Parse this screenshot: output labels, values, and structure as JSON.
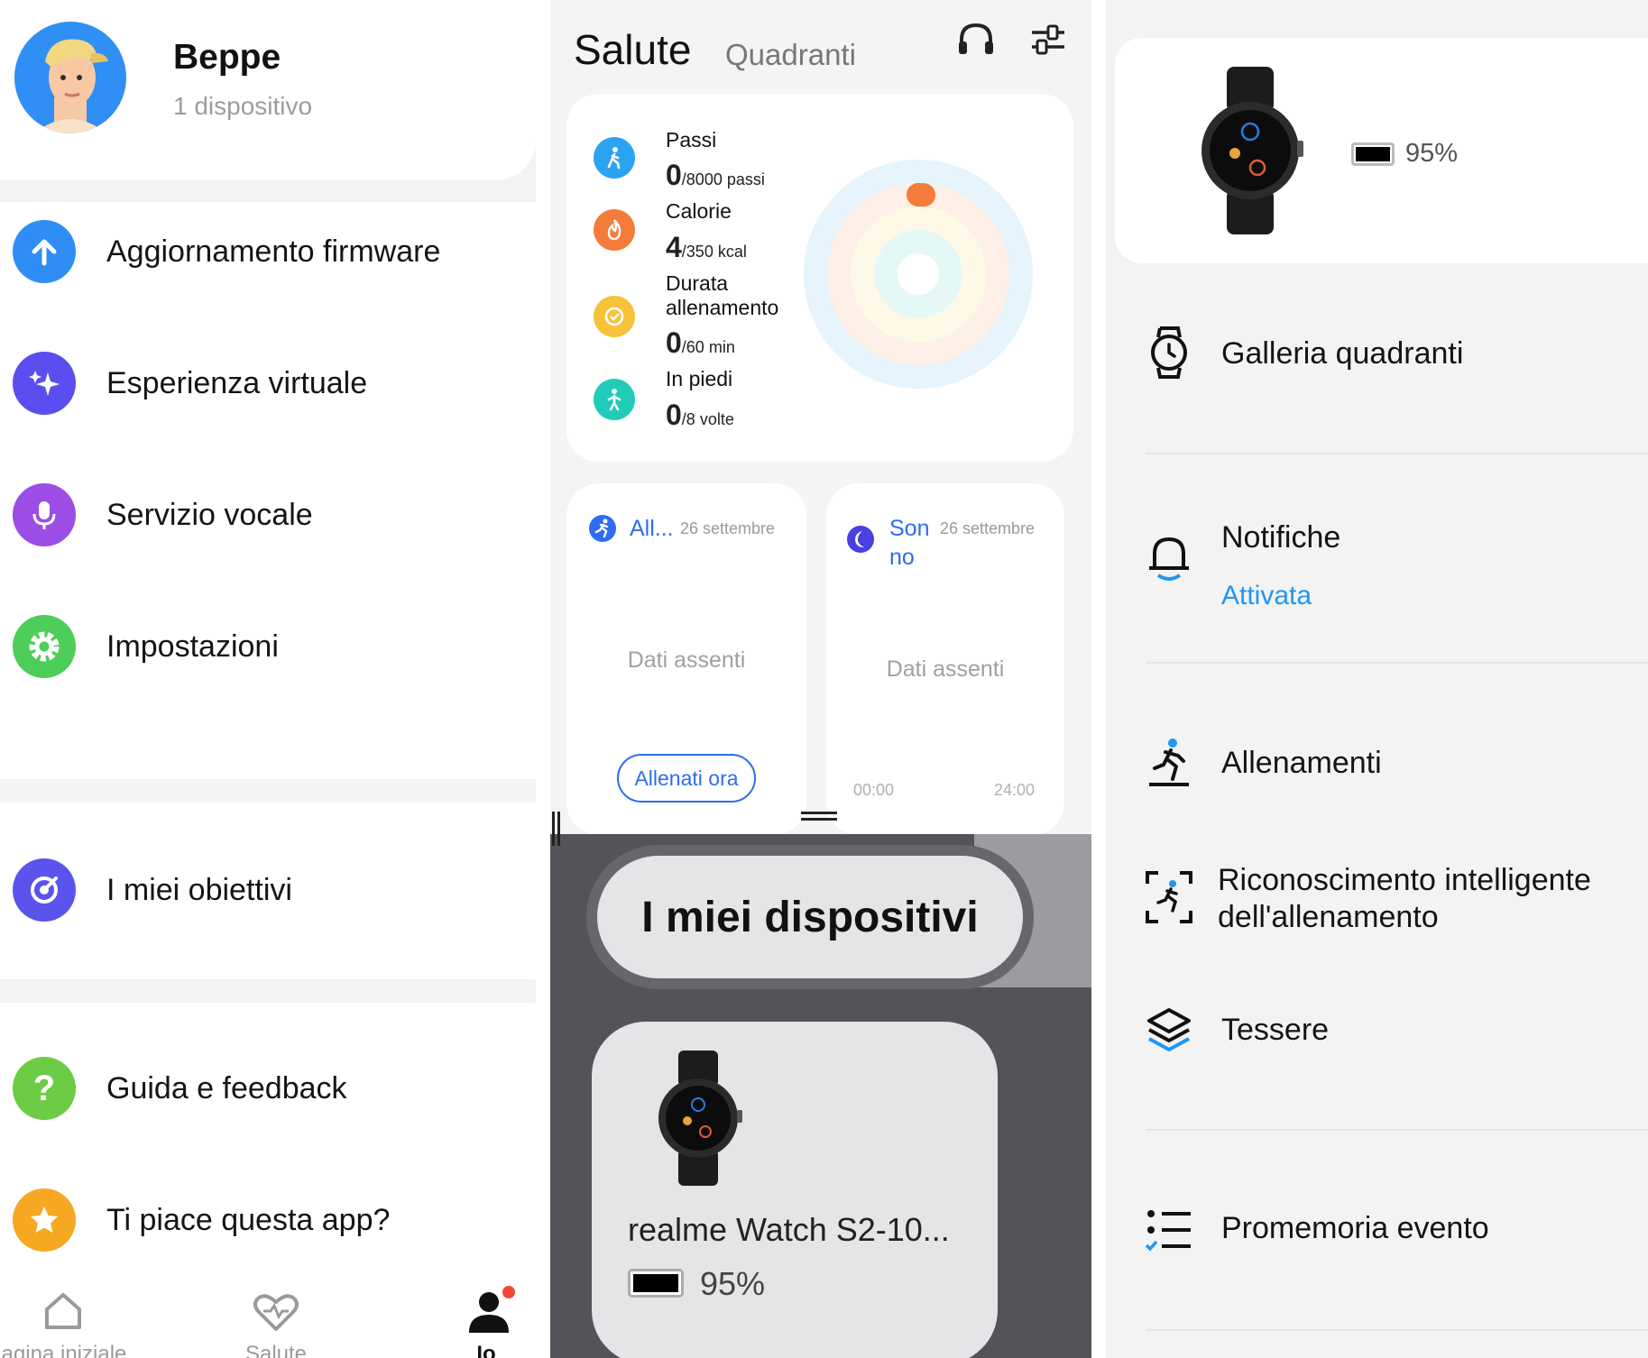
{
  "profile": {
    "name": "Beppe",
    "devices": "1 dispositivo"
  },
  "menu": {
    "firmware": "Aggiornamento firmware",
    "virtual": "Esperienza virtuale",
    "voice": "Servizio vocale",
    "settings": "Impostazioni",
    "goals": "I miei obiettivi",
    "help": "Guida e feedback",
    "rate": "Ti piace questa app?"
  },
  "tabs": {
    "home": "agina iniziale",
    "health": "Salute",
    "me": "Io"
  },
  "health": {
    "title": "Salute",
    "subtitle": "Quadranti",
    "stats": [
      {
        "label": "Passi",
        "value": "0",
        "target": "/8000",
        "unit": "passi",
        "color": "#2aa3f2",
        "progress": 0
      },
      {
        "label": "Calorie",
        "value": "4",
        "target": "/350",
        "unit": "kcal",
        "color": "#f47b3a",
        "progress": 0.011
      },
      {
        "label_1": "Durata",
        "label_2": "allenamento",
        "value": "0",
        "target": "/60",
        "unit": "min",
        "color": "#f7c23a",
        "progress": 0
      },
      {
        "label": "In piedi",
        "value": "0",
        "target": "/8",
        "unit": "volte",
        "color": "#22cbb8",
        "progress": 0
      }
    ],
    "workout_card": {
      "title": "All...",
      "date": "26 settembre",
      "empty": "Dati assenti",
      "button": "Allenati ora"
    },
    "sleep_card": {
      "title_1": "Son",
      "title_2": "no",
      "date": "26 settembre",
      "empty": "Dati assenti",
      "axis_start": "00:00",
      "axis_end": "24:00"
    }
  },
  "devices_section": {
    "title": "I miei dispositivi",
    "device_name": "realme Watch S2-10...",
    "battery": "95%"
  },
  "device": {
    "battery": "95%",
    "items": {
      "watchfaces": "Galleria quadranti",
      "notifications": "Notifiche",
      "notifications_status": "Attivata",
      "workouts": "Allenamenti",
      "smart_recognition_1": "Riconoscimento intelligente",
      "smart_recognition_2": "dell'allenamento",
      "cards": "Tessere",
      "reminders": "Promemoria evento"
    }
  },
  "colors": {
    "accent_blue": "#2f6df0",
    "status_blue": "#2196f3",
    "firmware": "#2e8ef6",
    "virtual": "#5b4ef0",
    "voice": "#9b4de6",
    "settings": "#4cce59",
    "goals": "#5a54ec",
    "help": "#6ccc46",
    "rate": "#f7a823",
    "badge": "#f2473a"
  }
}
